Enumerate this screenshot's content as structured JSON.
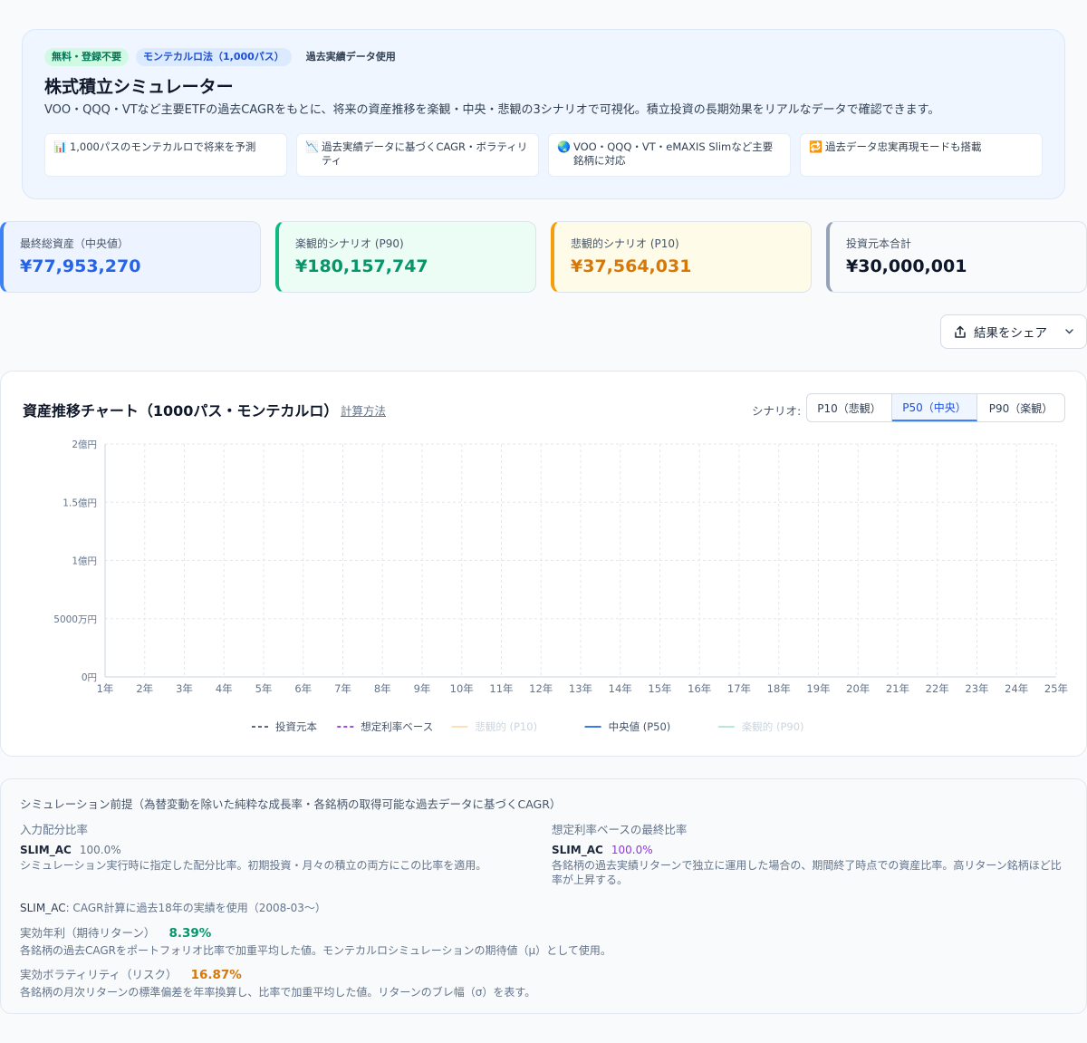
{
  "hero": {
    "badges": [
      "無料・登録不要",
      "モンテカルロ法（1,000パス）",
      "過去実績データ使用"
    ],
    "title": "株式積立シミュレーター",
    "description": "VOO・QQQ・VTなど主要ETFの過去CAGRをもとに、将来の資産推移を楽観・中央・悲観の3シナリオで可視化。積立投資の長期効果をリアルなデータで確認できます。",
    "features": [
      {
        "icon": "bar-chart-emoji",
        "glyph": "📊",
        "text": "1,000パスのモンテカルロで将来を予測"
      },
      {
        "icon": "chart-down-emoji",
        "glyph": "📉",
        "text": "過去実績データに基づくCAGR・ボラティリティ"
      },
      {
        "icon": "globe-emoji",
        "glyph": "🌏",
        "text": "VOO・QQQ・VT・eMAXIS Slimなど主要銘柄に対応"
      },
      {
        "icon": "repeat-emoji",
        "glyph": "🔁",
        "text": "過去データ忠実再現モードも搭載"
      }
    ]
  },
  "stats": [
    {
      "label": "最終総資産（中央値）",
      "value": "¥77,953,270"
    },
    {
      "label": "楽観的シナリオ (P90)",
      "value": "¥180,157,747"
    },
    {
      "label": "悲観的シナリオ (P10)",
      "value": "¥37,564,031"
    },
    {
      "label": "投資元本合計",
      "value": "¥30,000,001"
    }
  ],
  "share": {
    "label": "結果をシェア"
  },
  "chart_header": {
    "title": "資産推移チャート（1000パス・モンテカルロ）",
    "calc_link": "計算方法",
    "scenario_label": "シナリオ:",
    "options": [
      "P10（悲観）",
      "P50（中央）",
      "P90（楽観）"
    ],
    "selected": "P50（中央）"
  },
  "chart_data": {
    "type": "line",
    "title": "",
    "xlabel": "",
    "ylabel": "",
    "x": [
      "1年",
      "2年",
      "3年",
      "4年",
      "5年",
      "6年",
      "7年",
      "8年",
      "9年",
      "10年",
      "11年",
      "12年",
      "13年",
      "14年",
      "15年",
      "16年",
      "17年",
      "18年",
      "19年",
      "20年",
      "21年",
      "22年",
      "23年",
      "24年",
      "25年"
    ],
    "ylim": [
      0,
      200000000
    ],
    "y_ticks": [
      {
        "value": 0,
        "label": "0円"
      },
      {
        "value": 50000000,
        "label": "5000万円"
      },
      {
        "value": 100000000,
        "label": "1億円"
      },
      {
        "value": 150000000,
        "label": "1.5億円"
      },
      {
        "value": 200000000,
        "label": "2億円"
      }
    ],
    "grid": true,
    "legend_position": "bottom",
    "series": [
      {
        "name": "投資元本",
        "color": "#475569",
        "style": "dashed",
        "visible": true,
        "values": []
      },
      {
        "name": "想定利率ベース",
        "color": "#9333ea",
        "style": "dashed",
        "visible": true,
        "values": []
      },
      {
        "name": "悲観的 (P10)",
        "color": "#fcd9a8",
        "style": "solid",
        "visible": false,
        "values": []
      },
      {
        "name": "中央値 (P50)",
        "color": "#2563eb",
        "style": "solid",
        "visible": true,
        "values": []
      },
      {
        "name": "楽観的 (P90)",
        "color": "#a7e3cf",
        "style": "solid",
        "visible": false,
        "values": []
      }
    ]
  },
  "premise": {
    "title": "シミュレーション前提（為替変動を除いた純粋な成長率・各銘柄の取得可能な過去データに基づくCAGR）",
    "input_alloc": {
      "heading": "入力配分比率",
      "ticker": "SLIM_AC",
      "pct": "100.0%",
      "note": "シミュレーション実行時に指定した配分比率。初期投資・月々の積立の両方にこの比率を適用。"
    },
    "final_alloc": {
      "heading": "想定利率ベースの最終比率",
      "ticker": "SLIM_AC",
      "pct": "100.0%",
      "note_line1": "各銘柄の過去実績リターンで独立に運用した場合の、期間終了時点での資産比率。高リターン銘柄ほど比",
      "note_line2": "率が上昇する。"
    },
    "cagr_note": {
      "ticker": "SLIM_AC",
      "text": ": CAGR計算に過去18年の実績を使用（2008-03〜）"
    },
    "return": {
      "label": "実効年利（期待リターン）",
      "value": "8.39%",
      "note": "各銘柄の過去CAGRをポートフォリオ比率で加重平均した値。モンテカルロシミュレーションの期待値（μ）として使用。"
    },
    "volatility": {
      "label": "実効ボラティリティ（リスク）",
      "value": "16.87%",
      "note": "各銘柄の月次リターンの標準偏差を年率換算し、比率で加重平均した値。リターンのブレ幅（σ）を表す。"
    }
  }
}
